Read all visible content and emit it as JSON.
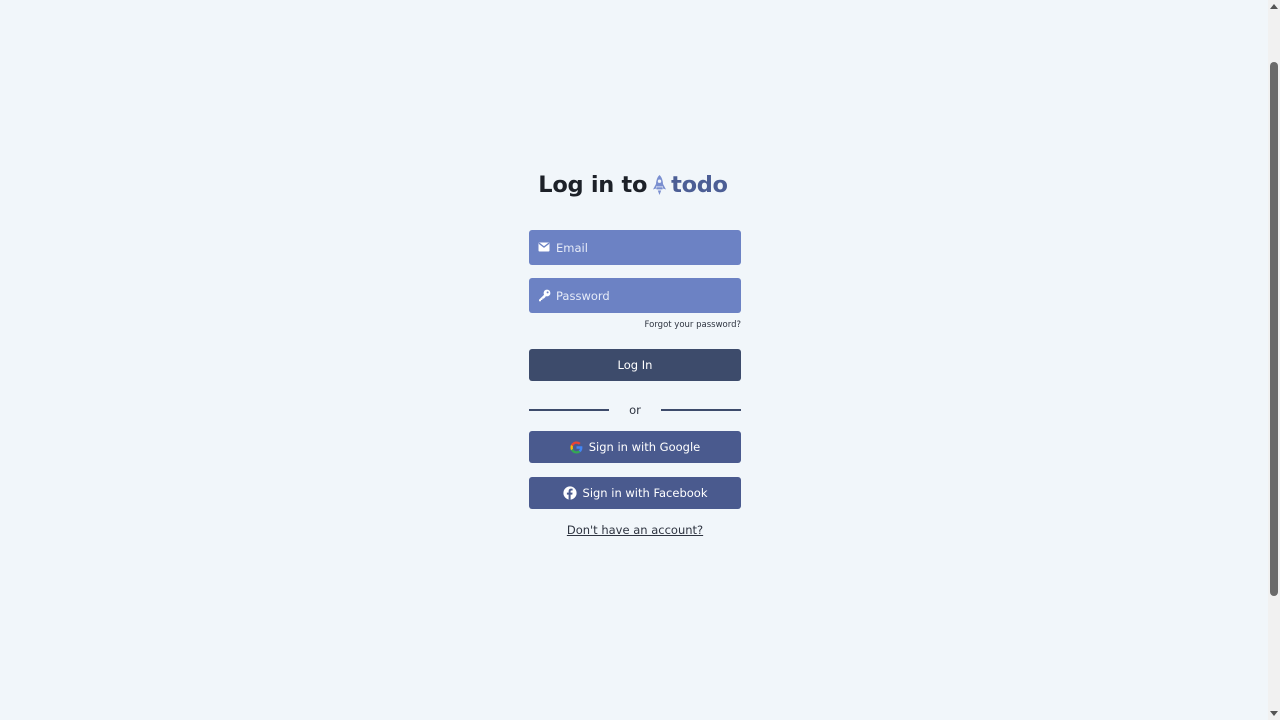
{
  "page": {
    "title_prefix": "Log in to",
    "brand": "todo"
  },
  "form": {
    "email_placeholder": "Email",
    "password_placeholder": "Password",
    "forgot_link": "Forgot your password?",
    "login_button": "Log In",
    "divider_text": "or",
    "google_button": "Sign in with Google",
    "facebook_button": "Sign in with Facebook",
    "signup_link": "Don't have an account?"
  },
  "icons": {
    "brand": "rocket-icon",
    "email": "mail-icon",
    "password": "key-icon",
    "google": "google-icon",
    "facebook": "facebook-icon"
  },
  "colors": {
    "background": "#f1f6fa",
    "input": "#6c82c4",
    "login_button": "#3d4b6b",
    "social_button": "#4a5a8e",
    "brand": "#4c5e95",
    "rocket": "#7a8fd0"
  }
}
